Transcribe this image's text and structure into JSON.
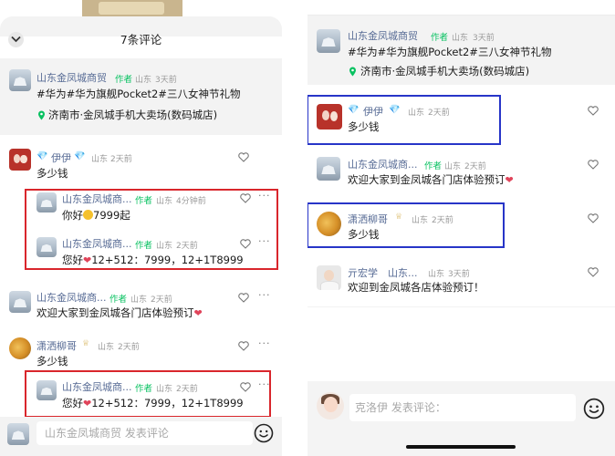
{
  "left": {
    "header_title": "7条评论",
    "post": {
      "author": "山东金凤城商贸",
      "author_badge": "作者",
      "region": "山东",
      "time": "3天前",
      "content": "#华为#华为旗舰Pocket2#三八女神节礼物",
      "location": "济南市·金凤城手机大卖场(数码城店)"
    },
    "comments": [
      {
        "name": "伊伊",
        "region": "山东",
        "time": "2天前",
        "text": "多少钱"
      },
      {
        "name": "山东金凤城商...",
        "badge": "作者",
        "region": "山东",
        "time": "4分钟前",
        "text_pre": "你好",
        "text_post": "7999起"
      },
      {
        "name": "山东金凤城商...",
        "badge": "作者",
        "region": "山东",
        "time": "2天前",
        "text_pre": "您好",
        "text_post": "12+512：7999，12+1T8999"
      },
      {
        "name": "山东金凤城商...",
        "badge": "作者",
        "region": "山东",
        "time": "2天前",
        "text_pre": "欢迎大家到金凤城各门店体验预订"
      },
      {
        "name": "潇洒柳哥",
        "region": "山东",
        "time": "2天前",
        "text": "多少钱"
      },
      {
        "name": "山东金凤城商...",
        "badge": "作者",
        "region": "山东",
        "time": "2天前",
        "text_pre": "您好",
        "text_post": "12+512：7999，12+1T8999"
      }
    ],
    "input_placeholder": "山东金凤城商贸 发表评论"
  },
  "right": {
    "post": {
      "author": "山东金凤城商贸",
      "author_badge": "作者",
      "region": "山东",
      "time": "3天前",
      "content": "#华为#华为旗舰Pocket2#三八女神节礼物",
      "location": "济南市·金凤城手机大卖场(数码城店)"
    },
    "comments": [
      {
        "name": "伊伊",
        "region": "山东",
        "time": "2天前",
        "text": "多少钱"
      },
      {
        "name": "山东金凤城商...",
        "badge": "作者",
        "region": "山东",
        "time": "2天前",
        "text_pre": "欢迎大家到金凤城各门店体验预订"
      },
      {
        "name": "潇洒柳哥",
        "region": "山东",
        "time": "2天前",
        "text": "多少钱"
      },
      {
        "name": "亓宏学",
        "region": "山东...",
        "time": "3天前",
        "text": "欢迎到金凤城各店体验预订！"
      }
    ],
    "input_placeholder": "克洛伊 发表评论："
  },
  "colors": {
    "highlight_red": "#d9262c",
    "highlight_blue": "#2735c8",
    "name": "#576b95",
    "author_badge": "#07c160"
  },
  "icons": [
    "chevron-down-icon",
    "location-pin-icon",
    "heart-icon",
    "more-icon",
    "diamond-icon",
    "smile-emoji-icon",
    "heart-emoji-icon",
    "sticker-icon"
  ]
}
